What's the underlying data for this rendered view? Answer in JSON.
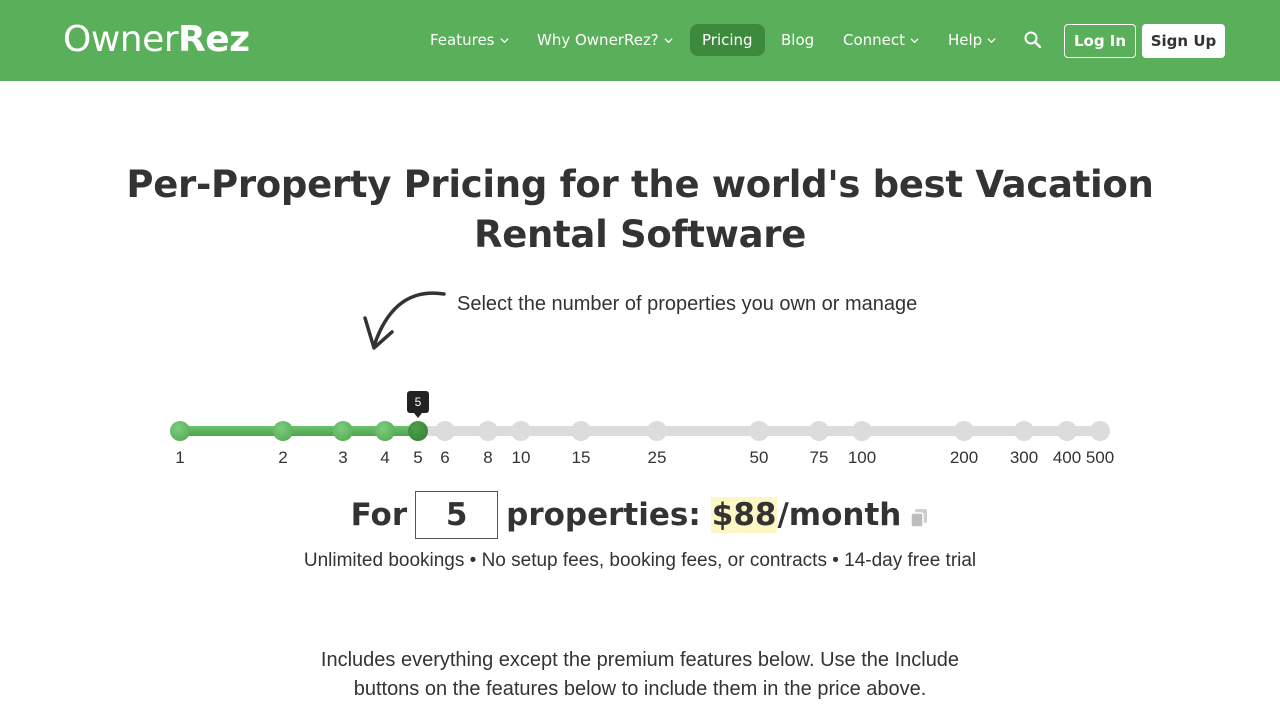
{
  "header": {
    "logo_part1": "Owner",
    "logo_part2": "Rez",
    "nav": [
      {
        "label": "Features",
        "dropdown": true
      },
      {
        "label": "Why OwnerRez?",
        "dropdown": true
      },
      {
        "label": "Pricing",
        "dropdown": false,
        "active": true
      },
      {
        "label": "Blog",
        "dropdown": false
      },
      {
        "label": "Connect",
        "dropdown": true
      },
      {
        "label": "Help",
        "dropdown": true
      }
    ],
    "search_icon": "search-icon",
    "login_label": "Log In",
    "signup_label": "Sign Up"
  },
  "colors": {
    "brand_green": "#5aaf5a",
    "active_nav": "#3d8a3d",
    "slider_on": "#5aaf5a",
    "slider_off": "#dcdcdc",
    "price_highlight": "#fdf7c3"
  },
  "hero": {
    "title": "Per-Property Pricing for the world's best Vacation Rental Software",
    "instruction": "Select the number of properties you own or manage",
    "arrow_icon": "curved-arrow-icon"
  },
  "slider": {
    "ticks": [
      "1",
      "2",
      "3",
      "4",
      "5",
      "6",
      "8",
      "10",
      "15",
      "25",
      "50",
      "75",
      "100",
      "200",
      "300",
      "400",
      "500"
    ],
    "selected": "5",
    "tooltip": "5"
  },
  "price": {
    "prefix": "For",
    "quantity": "5",
    "middle": "properties:",
    "amount": "$88",
    "period": "/month",
    "copy_icon": "copy-icon"
  },
  "subline": "Unlimited bookings • No setup fees, booking fees, or contracts • 14-day free trial",
  "includes": "Includes everything except the premium features below. Use the Include buttons on the features below to include them in the price above."
}
